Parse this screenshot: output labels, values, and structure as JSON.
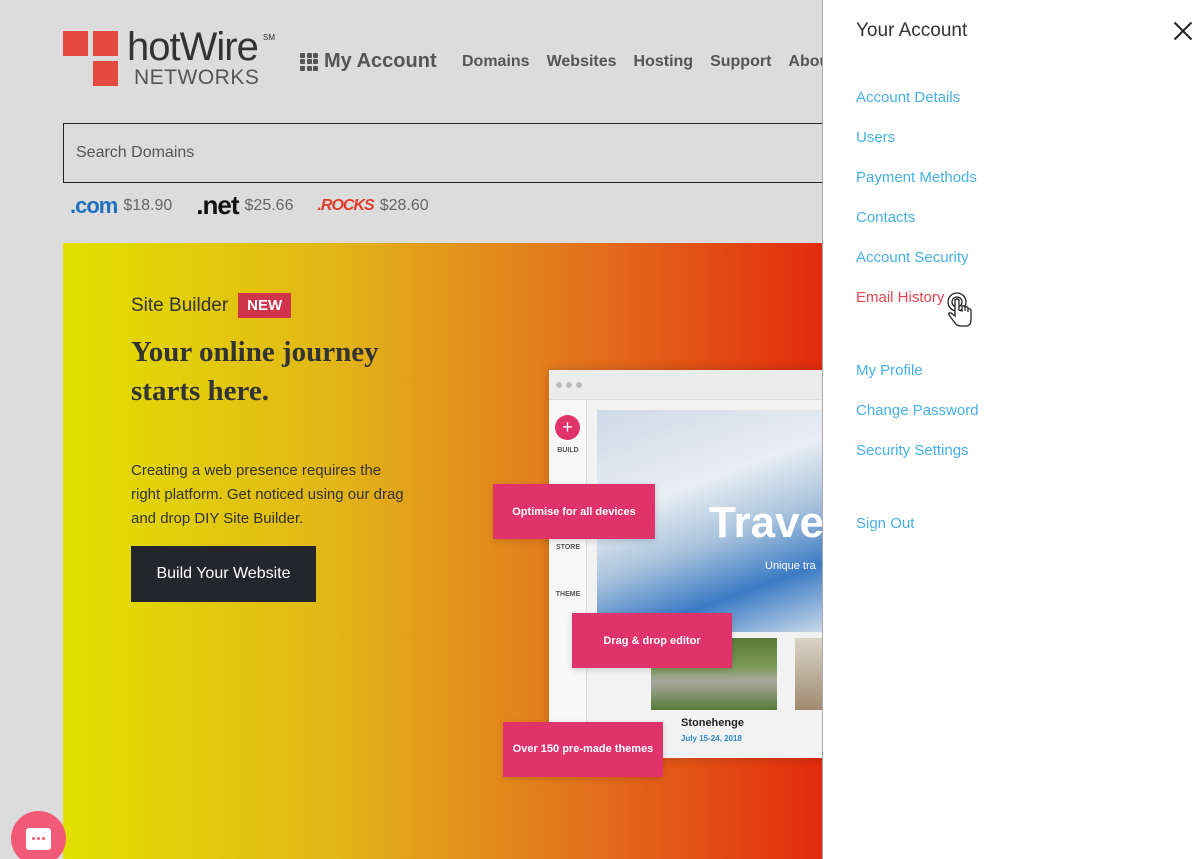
{
  "header": {
    "logo": {
      "brand": "hotWire",
      "service_mark": "SM",
      "subtitle": "NETWORKS"
    },
    "my_account_label": "My Account",
    "nav": [
      "Domains",
      "Websites",
      "Hosting",
      "Support",
      "About"
    ]
  },
  "search": {
    "placeholder": "Search Domains",
    "value": ""
  },
  "tlds": [
    {
      "name": ".com",
      "price": "$18.90"
    },
    {
      "name": ".net",
      "price": "$25.66"
    },
    {
      "name": ".ROCKS",
      "price": "$28.60"
    }
  ],
  "banner": {
    "eyebrow": "Site Builder",
    "badge": "NEW",
    "headline": "Your online journey starts here.",
    "body": "Creating a web presence requires the right platform. Get noticed using our drag and drop DIY Site Builder.",
    "cta": "Build Your Website",
    "mockup": {
      "sidebar_labels": [
        "BUILD",
        "STORE",
        "THEME"
      ],
      "hero_title": "Trave",
      "hero_subtitle": "Unique tra",
      "card_title": "Stonehenge",
      "card_date": "July 15-24, 2018",
      "callouts": [
        "Optimise for all devices",
        "Drag & drop editor",
        "Over 150 pre-made themes"
      ]
    }
  },
  "panel": {
    "title": "Your Account",
    "links": [
      "Account Details",
      "Users",
      "Payment Methods",
      "Contacts",
      "Account Security",
      "Email History"
    ],
    "active_link": "Email History",
    "profile_links": [
      "My Profile",
      "Change Password",
      "Security Settings"
    ],
    "sign_out": "Sign Out"
  },
  "colors": {
    "brand_red": "#e4493f",
    "link_blue": "#45b1e8",
    "active_red": "#e8454f",
    "accent_pink": "#e0336b"
  }
}
